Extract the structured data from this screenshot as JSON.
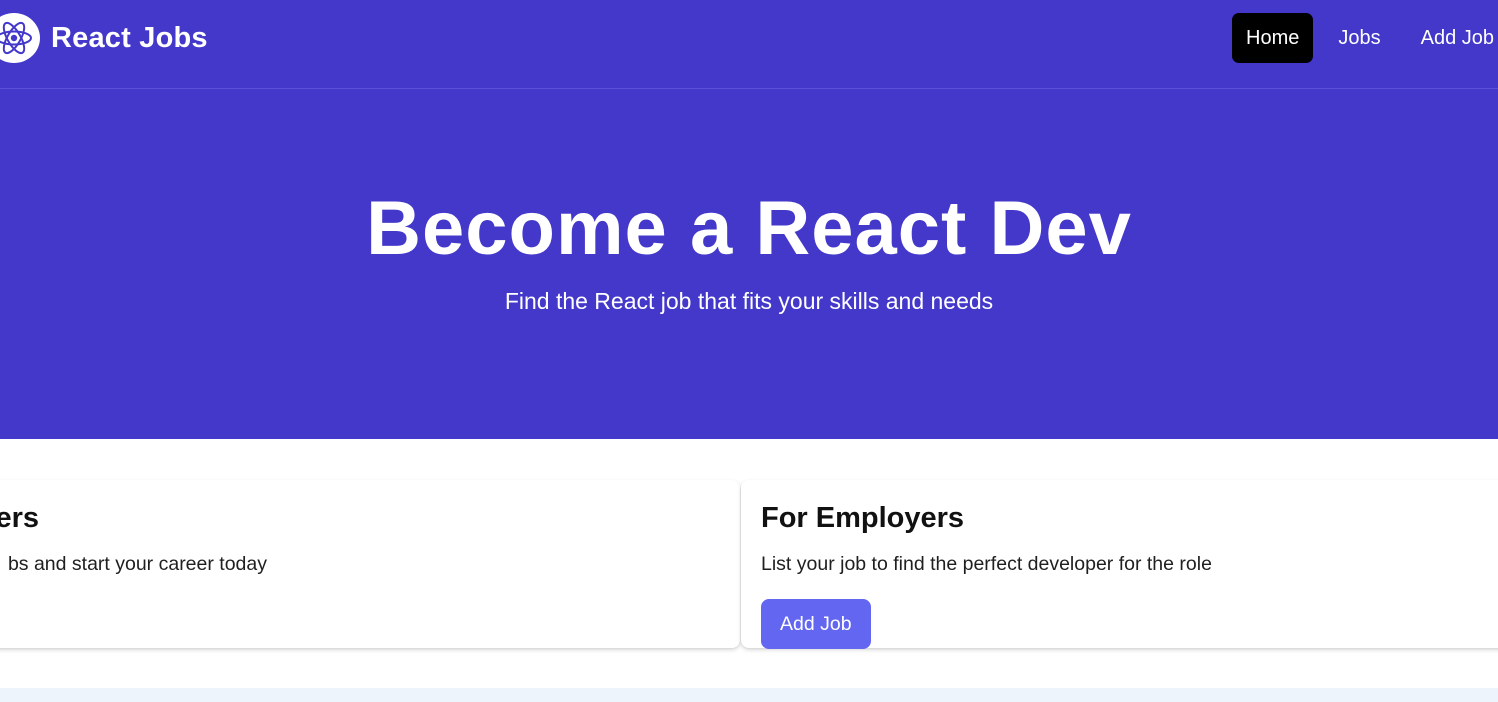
{
  "navbar": {
    "brand": "React Jobs",
    "links": [
      {
        "label": "Home",
        "active": true
      },
      {
        "label": "Jobs",
        "active": false
      },
      {
        "label": "Add Job",
        "active": false
      }
    ]
  },
  "hero": {
    "title": "Become a React Dev",
    "subtitle": "Find the React job that fits your skills and needs"
  },
  "cards": {
    "developers": {
      "title": "ers",
      "text": "bs and start your career today"
    },
    "employers": {
      "title": "For Employers",
      "text": "List your job to find the perfect developer for the role",
      "button": "Add Job"
    }
  },
  "colors": {
    "primary": "#4338ca",
    "accent": "#6366f1",
    "active": "#000000"
  }
}
